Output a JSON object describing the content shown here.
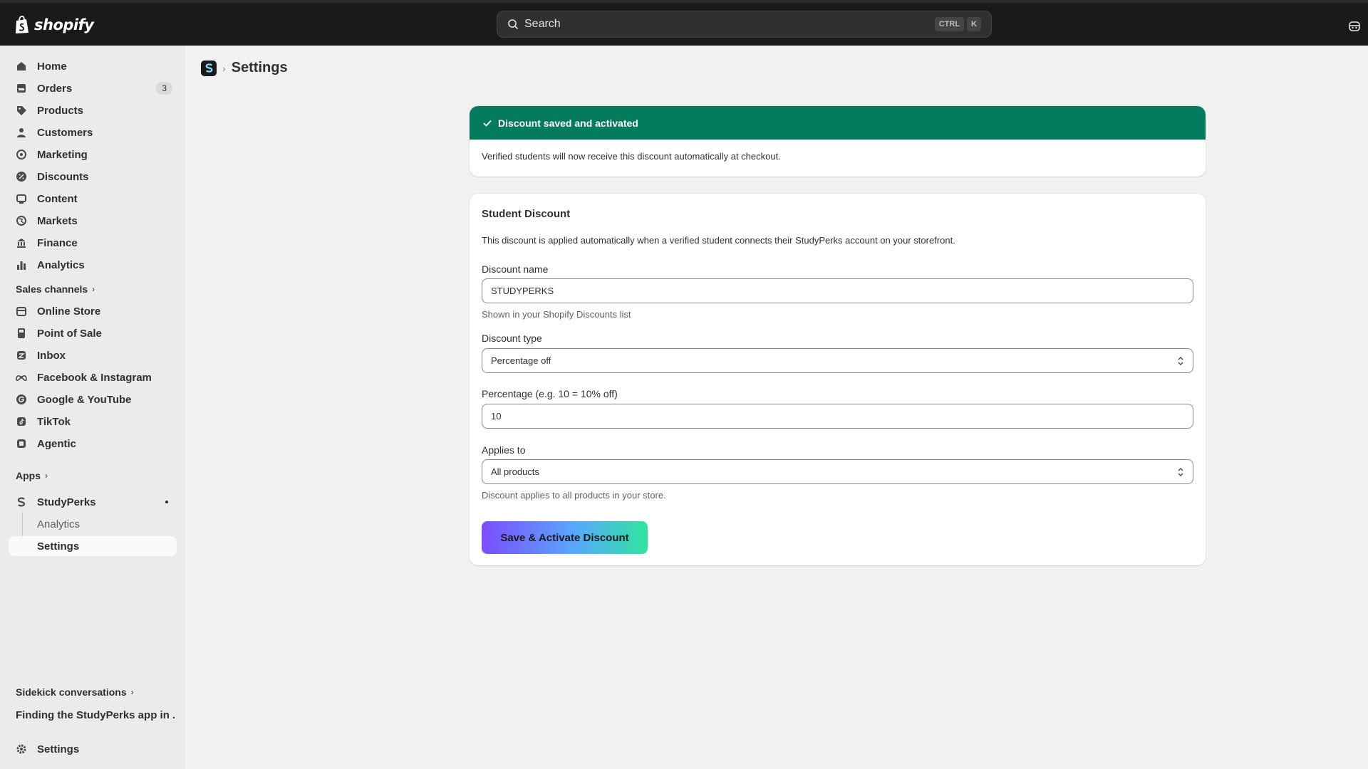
{
  "topbar": {
    "brand": "shopify",
    "search_placeholder": "Search",
    "shortcut_keys": [
      "CTRL",
      "K"
    ]
  },
  "sidebar": {
    "main_items": [
      {
        "label": "Home",
        "icon": "home-icon"
      },
      {
        "label": "Orders",
        "icon": "orders-icon",
        "badge": "3"
      },
      {
        "label": "Products",
        "icon": "tag-icon"
      },
      {
        "label": "Customers",
        "icon": "person-icon"
      },
      {
        "label": "Marketing",
        "icon": "target-icon"
      },
      {
        "label": "Discounts",
        "icon": "discount-icon"
      },
      {
        "label": "Content",
        "icon": "content-icon"
      },
      {
        "label": "Markets",
        "icon": "globe-icon"
      },
      {
        "label": "Finance",
        "icon": "bank-icon"
      },
      {
        "label": "Analytics",
        "icon": "bar-chart-icon"
      }
    ],
    "sales_channels_heading": "Sales channels",
    "sales_channels": [
      {
        "label": "Online Store",
        "icon": "store-icon"
      },
      {
        "label": "Point of Sale",
        "icon": "pos-icon"
      },
      {
        "label": "Inbox",
        "icon": "inbox-icon"
      },
      {
        "label": "Facebook & Instagram",
        "icon": "meta-icon"
      },
      {
        "label": "Google & YouTube",
        "icon": "google-icon"
      },
      {
        "label": "TikTok",
        "icon": "tiktok-icon"
      },
      {
        "label": "Agentic",
        "icon": "agentic-icon"
      }
    ],
    "apps_heading": "Apps",
    "app_name": "StudyPerks",
    "app_subitems": [
      "Analytics",
      "Settings"
    ],
    "active_subitem": "Settings",
    "sidekick_heading": "Sidekick conversations",
    "sidekick_item": "Finding the StudyPerks app in ...",
    "settings_label": "Settings"
  },
  "page": {
    "title": "Settings",
    "banner": {
      "title": "Discount saved and activated",
      "message": "Verified students will now receive this discount automatically at checkout.",
      "color": "#047b5d"
    },
    "form": {
      "title": "Student Discount",
      "description": "This discount is applied automatically when a verified student connects their StudyPerks account on your storefront.",
      "discount_name_label": "Discount name",
      "discount_name_value": "STUDYPERKS",
      "discount_name_help": "Shown in your Shopify Discounts list",
      "discount_type_label": "Discount type",
      "discount_type_value": "Percentage off",
      "percentage_label": "Percentage (e.g. 10 = 10% off)",
      "percentage_value": "10",
      "applies_to_label": "Applies to",
      "applies_to_value": "All products",
      "applies_to_help": "Discount applies to all products in your store.",
      "submit_label": "Save & Activate Discount"
    }
  }
}
